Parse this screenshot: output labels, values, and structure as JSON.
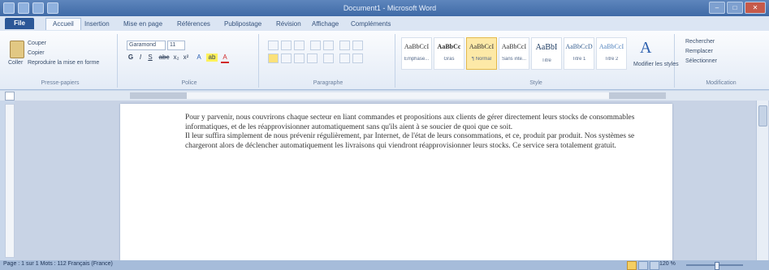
{
  "window": {
    "title": "Document1 - Microsoft Word",
    "controls": {
      "minimize": "–",
      "maximize": "□",
      "close": "✕"
    }
  },
  "ribbon_tabs": {
    "file": "File",
    "items": [
      "Accueil",
      "Insertion",
      "Mise en page",
      "Références",
      "Publipostage",
      "Révision",
      "Affichage",
      "Compléments"
    ]
  },
  "clipboard": {
    "paste": "Coller",
    "cut": "Couper",
    "copy": "Copier",
    "format_painter": "Reproduire la mise en forme",
    "label": "Presse-papiers"
  },
  "font": {
    "name": "Garamond",
    "size": "11",
    "label": "Police",
    "buttons": [
      "G",
      "I",
      "S",
      "abc",
      "x₂",
      "x²",
      "A",
      "ab",
      "A"
    ]
  },
  "paragraph": {
    "label": "Paragraphe"
  },
  "styles": {
    "label": "Style",
    "tiles": [
      {
        "preview": "AaBbCcI",
        "name": "Emphase..."
      },
      {
        "preview": "AaBbCc",
        "name": "Gras"
      },
      {
        "preview": "AaBbCcI",
        "name": "¶ Normal"
      },
      {
        "preview": "AaBbCcI",
        "name": "Sans inte..."
      },
      {
        "preview": "AaBbI",
        "name": "Titre"
      },
      {
        "preview": "AaBbCcD",
        "name": "Titre 1"
      },
      {
        "preview": "AaBbCcI",
        "name": "Titre 2"
      }
    ],
    "change": "Modifier les styles"
  },
  "editing": {
    "label": "Modification",
    "find": "Rechercher",
    "replace": "Remplacer",
    "select": "Sélectionner"
  },
  "document": {
    "paragraphs": [
      "Pour y parvenir, nous couvrirons chaque secteur en liant commandes et propositions aux clients de gérer directement leurs stocks de consommables informatiques, et de les réapprovisionner automatiquement sans qu'ils aient à se soucier de quoi que ce soit.",
      "Il leur suffira simplement de nous prévenir régulièrement, par Internet, de l'état de leurs consommations, et ce, produit par produit. Nos systèmes se chargeront alors de déclencher automatiquement les livraisons qui viendront réapprovisionner leurs stocks. Ce service sera totalement gratuit."
    ]
  },
  "statusbar": {
    "left": "Page : 1 sur 1   Mots : 112   Français (France)",
    "zoom": "120 %"
  }
}
